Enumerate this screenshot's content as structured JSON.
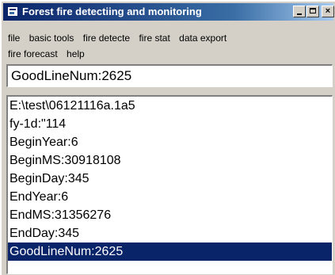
{
  "window": {
    "title": "Forest fire detectiing and monitoring",
    "min_glyph": "",
    "max_glyph": "",
    "close_glyph": "×"
  },
  "menu": {
    "row1": [
      "file",
      "basic tools",
      "fire detecte",
      "fire stat",
      "data export"
    ],
    "row2": [
      "fire forecast",
      "help"
    ]
  },
  "input": {
    "value": "GoodLineNum:2625"
  },
  "list": {
    "items": [
      "E:\\test\\06121116a.1a5",
      "fy-1d:\"114",
      "BeginYear:6",
      "BeginMS:30918108",
      "BeginDay:345",
      "EndYear:6",
      "EndMS:31356276",
      "EndDay:345",
      "GoodLineNum:2625"
    ],
    "selected_index": 8
  },
  "colors": {
    "title_active": "#0a246a",
    "selection": "#0a246a",
    "face": "#d4d0c8"
  }
}
